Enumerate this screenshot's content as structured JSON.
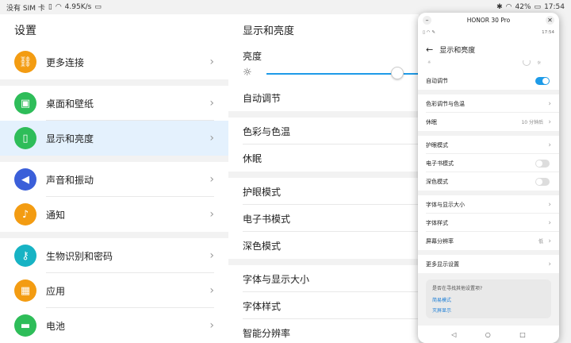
{
  "statusbar": {
    "carrier": "没有 SIM 卡",
    "speed": "4.95K/s",
    "battery": "42%",
    "time": "17:54"
  },
  "settings": {
    "title": "设置",
    "groups": [
      [
        {
          "label": "更多连接",
          "icon": "link-icon",
          "color": "#f39c12"
        }
      ],
      [
        {
          "label": "桌面和壁纸",
          "icon": "image-icon",
          "color": "#2ebd59"
        },
        {
          "label": "显示和亮度",
          "icon": "phone-brightness-icon",
          "color": "#2ebd59",
          "active": true
        }
      ],
      [
        {
          "label": "声音和振动",
          "icon": "speaker-icon",
          "color": "#3b5fd9"
        },
        {
          "label": "通知",
          "icon": "bell-icon",
          "color": "#f39c12"
        }
      ],
      [
        {
          "label": "生物识别和密码",
          "icon": "key-icon",
          "color": "#17b3c4"
        },
        {
          "label": "应用",
          "icon": "grid-icon",
          "color": "#f39c12"
        },
        {
          "label": "电池",
          "icon": "battery-icon",
          "color": "#2ebd59"
        }
      ]
    ]
  },
  "display": {
    "title": "显示和亮度",
    "brightness_label": "亮度",
    "brightness_level": 0.86,
    "auto_adjust": "自动调节",
    "color_temp": "色彩与色温",
    "sleep": "休眠",
    "eye_comfort": "护眼模式",
    "ebook": "电子书模式",
    "dark": "深色模式",
    "font_size": "字体与显示大小",
    "font_style": "字体样式",
    "resolution": "智能分辨率"
  },
  "phone": {
    "device_name": "HONOR 30 Pro",
    "status_time": "17:54",
    "header": "显示和亮度",
    "auto_adjust": "自动调节",
    "auto_adjust_on": true,
    "color_temp": "色彩调节与色温",
    "sleep": "休眠",
    "sleep_value": "10 分钟后",
    "eye_comfort": "护眼模式",
    "ebook": "电子书模式",
    "ebook_on": false,
    "dark": "深色模式",
    "dark_on": false,
    "font_size": "字体与显示大小",
    "font_style": "字体样式",
    "resolution": "屏幕分辨率",
    "resolution_value": "低",
    "more_display": "更多显示设置",
    "suggest_q": "是否在寻找其他设置项?",
    "suggest_link1": "简易模式",
    "suggest_link2": "灭屏显示"
  }
}
